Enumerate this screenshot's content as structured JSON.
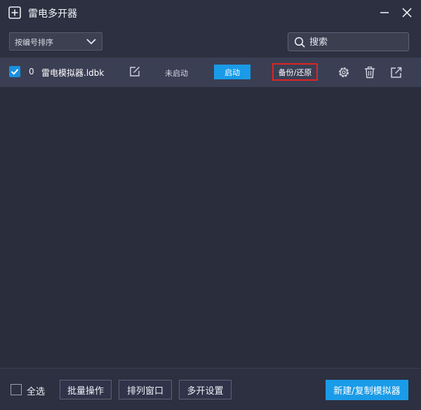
{
  "window": {
    "title": "雷电多开器",
    "icon": "plus-box-icon",
    "minimize_icon": "minimize-icon",
    "close_icon": "close-icon"
  },
  "toolbar": {
    "sort": {
      "selected": "按编号排序",
      "icon": "chevron-down-icon"
    },
    "search": {
      "placeholder": "搜索",
      "value": "",
      "icon": "search-icon"
    }
  },
  "emulators": [
    {
      "checked": true,
      "index": "0",
      "name": "雷电模拟器.ldbk",
      "status": "未启动",
      "start_label": "启动",
      "backup_label": "备份/还原",
      "icons": [
        "edit-icon",
        "gear-icon",
        "trash-icon",
        "share-icon"
      ]
    }
  ],
  "footer": {
    "select_all_label": "全选",
    "batch_label": "批量操作",
    "arrange_label": "排列窗口",
    "multi_settings_label": "多开设置",
    "new_copy_label": "新建/复制模拟器"
  },
  "colors": {
    "background": "#2a2d3b",
    "panel": "#2d3040",
    "row_bg": "#3b3f54",
    "accent": "#1a9be8",
    "highlight_border": "#e02424"
  }
}
